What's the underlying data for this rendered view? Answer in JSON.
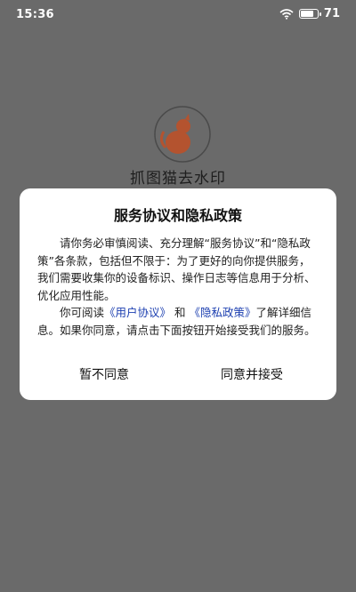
{
  "status_bar": {
    "time": "15:36",
    "battery": "71"
  },
  "app": {
    "title": "抓图猫去水印"
  },
  "dialog": {
    "title": "服务协议和隐私政策",
    "para1": "请你务必审慎阅读、充分理解“服务协议”和“隐私政策”各条款，包括但不限于：为了更好的向你提供服务，我们需要收集你的设备标识、操作日志等信息用于分析、优化应用性能。",
    "para2_prefix": "你可阅读",
    "user_agreement_link": "《用户协议》",
    "para2_and": " 和 ",
    "privacy_policy_link": "《隐私政策》",
    "para2_suffix": "了解详细信息。如果你同意，请点击下面按钮开始接受我们的服务。",
    "decline_label": "暂不同意",
    "accept_label": "同意并接受"
  },
  "colors": {
    "overlay": "#6a6a6a",
    "link": "#1c3fb0",
    "logo": "#b4532f"
  }
}
